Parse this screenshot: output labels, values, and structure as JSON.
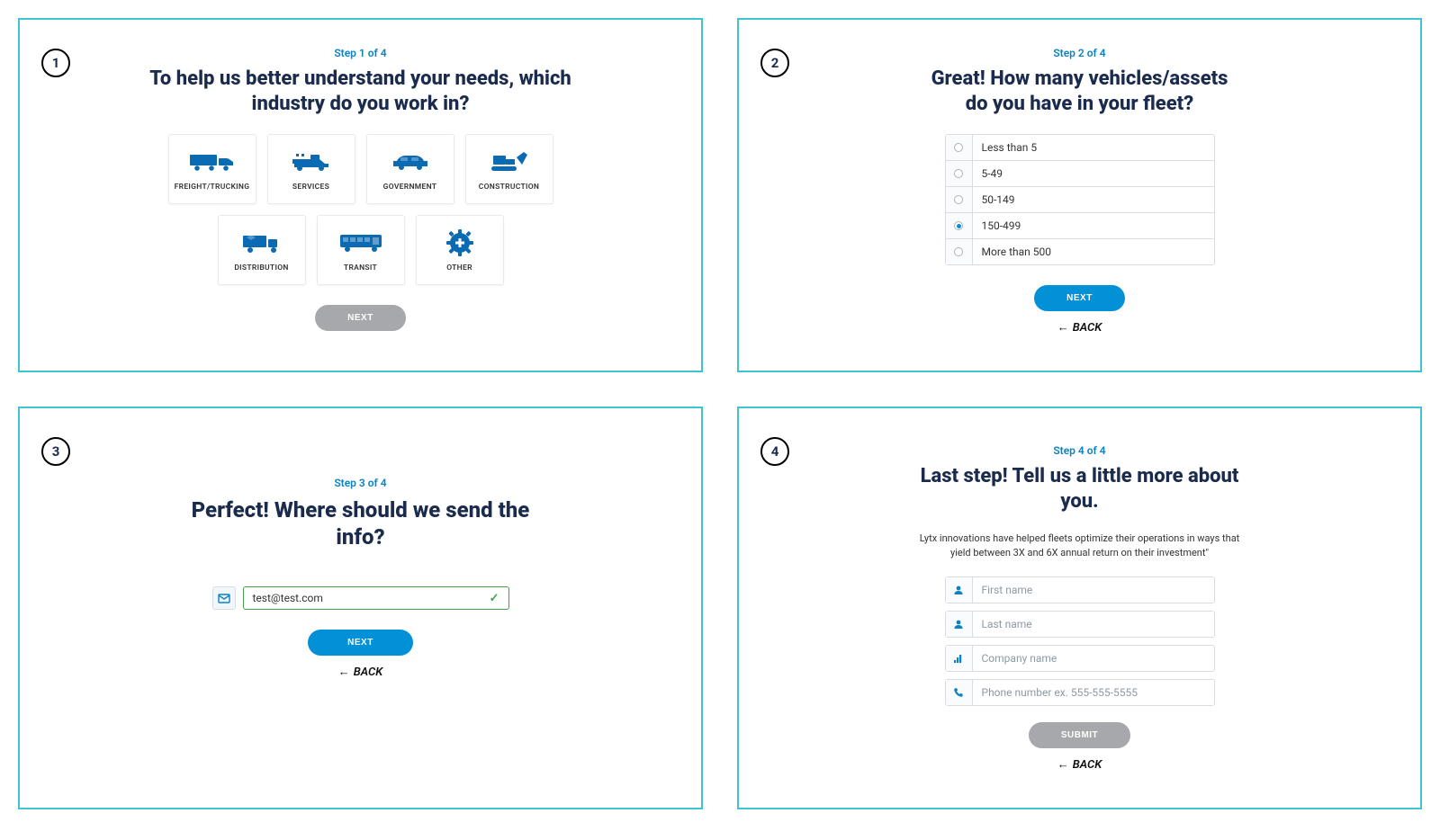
{
  "step1": {
    "badge": "1",
    "step_label": "Step 1 of 4",
    "heading": "To help us better understand your needs, which industry do you work in?",
    "tiles": [
      {
        "icon": "truck-icon",
        "label": "FREIGHT/TRUCKING"
      },
      {
        "icon": "pickup-icon",
        "label": "SERVICES"
      },
      {
        "icon": "car-icon",
        "label": "GOVERNMENT"
      },
      {
        "icon": "bulldozer-icon",
        "label": "CONSTRUCTION"
      },
      {
        "icon": "box-truck-icon",
        "label": "DISTRIBUTION"
      },
      {
        "icon": "bus-icon",
        "label": "TRANSIT"
      },
      {
        "icon": "gear-plus-icon",
        "label": "OTHER"
      }
    ],
    "next_label": "NEXT"
  },
  "step2": {
    "badge": "2",
    "step_label": "Step 2 of 4",
    "heading": "Great! How many vehicles/assets do you have in your fleet?",
    "options": [
      "Less than 5",
      "5-49",
      "50-149",
      "150-499",
      "More than 500"
    ],
    "selected_index": 3,
    "next_label": "NEXT",
    "back_label": "BACK"
  },
  "step3": {
    "badge": "3",
    "step_label": "Step 3 of 4",
    "heading": "Perfect! Where should we send the info?",
    "email_value": "test@test.com",
    "next_label": "NEXT",
    "back_label": "BACK"
  },
  "step4": {
    "badge": "4",
    "step_label": "Step 4 of 4",
    "heading": "Last step! Tell us a little more about you.",
    "subtext": "Lytx innovations have helped fleets optimize their operations in ways that yield between 3X and 6X annual return on their investment\"",
    "fields": [
      {
        "icon": "person-icon",
        "placeholder": "First name"
      },
      {
        "icon": "person-icon",
        "placeholder": "Last name"
      },
      {
        "icon": "building-icon",
        "placeholder": "Company name"
      },
      {
        "icon": "phone-icon",
        "placeholder": "Phone number   ex. 555-555-5555"
      }
    ],
    "submit_label": "SUBMIT",
    "back_label": "BACK"
  },
  "colors": {
    "teal_border": "#41c3cf",
    "blue": "#0290d7",
    "gray": "#a6a8ab",
    "valid_green": "#49a04a",
    "heading_navy": "#1a2b4d"
  }
}
